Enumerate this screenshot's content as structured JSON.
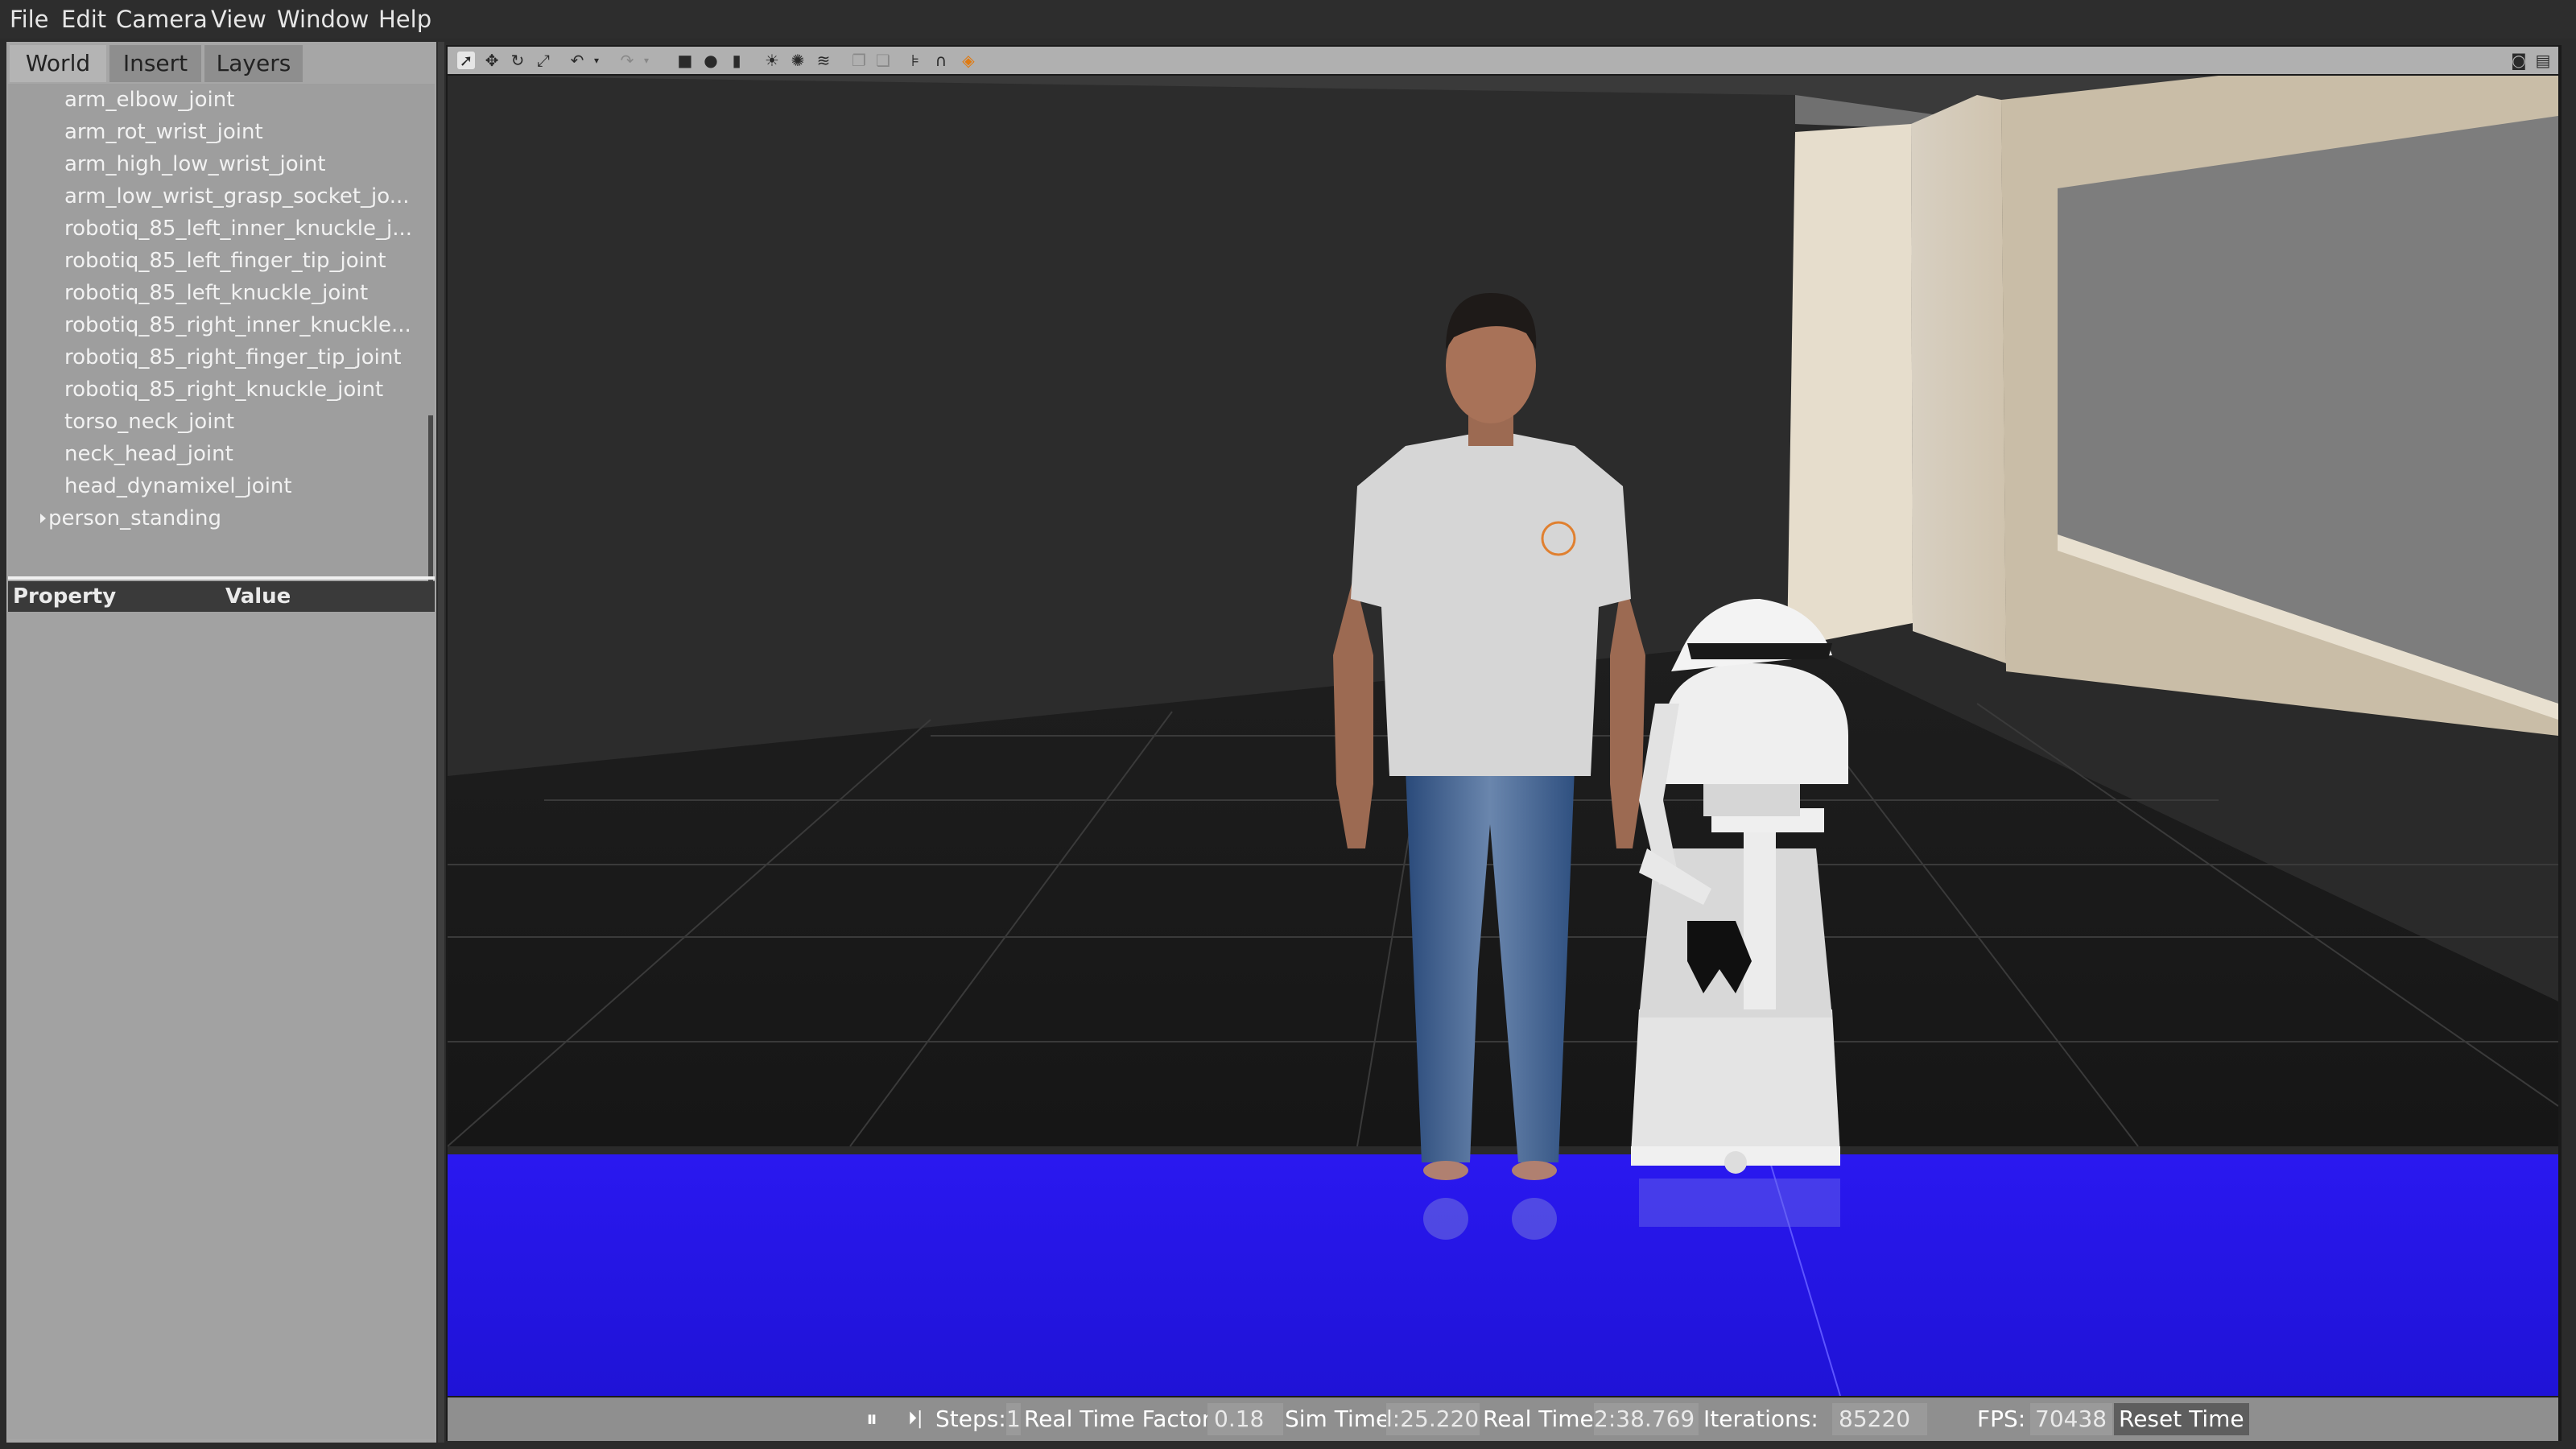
{
  "menu": {
    "items": [
      "File",
      "Edit",
      "Camera",
      "View",
      "Window",
      "Help"
    ]
  },
  "left_panel": {
    "tabs": [
      {
        "label": "World",
        "active": true
      },
      {
        "label": "Insert",
        "active": false
      },
      {
        "label": "Layers",
        "active": false
      }
    ],
    "tree": [
      {
        "label": "arm_elbow_joint"
      },
      {
        "label": "arm_rot_wrist_joint"
      },
      {
        "label": "arm_high_low_wrist_joint"
      },
      {
        "label": "arm_low_wrist_grasp_socket_jo..."
      },
      {
        "label": "robotiq_85_left_inner_knuckle_j..."
      },
      {
        "label": "robotiq_85_left_finger_tip_joint"
      },
      {
        "label": "robotiq_85_left_knuckle_joint"
      },
      {
        "label": "robotiq_85_right_inner_knuckle..."
      },
      {
        "label": "robotiq_85_right_finger_tip_joint"
      },
      {
        "label": "robotiq_85_right_knuckle_joint"
      },
      {
        "label": "torso_neck_joint"
      },
      {
        "label": "neck_head_joint"
      },
      {
        "label": "head_dynamixel_joint"
      }
    ],
    "tree_parent": {
      "label": "person_standing",
      "expanded": false
    },
    "property_header": {
      "property": "Property",
      "value": "Value"
    }
  },
  "toolbar": {
    "icons": [
      "select-arrow-icon",
      "translate-icon",
      "rotate-icon",
      "scale-icon",
      "undo-icon",
      "undo-dropdown-icon",
      "redo-icon",
      "redo-dropdown-icon",
      "box-shape-icon",
      "sphere-shape-icon",
      "cylinder-shape-icon",
      "point-light-icon",
      "spot-light-icon",
      "directional-light-icon",
      "copy-icon",
      "paste-icon",
      "align-icon",
      "snap-icon",
      "change-view-icon",
      "screenshot-icon",
      "record-icon"
    ]
  },
  "status": {
    "steps_label": "Steps:",
    "steps_value": "1",
    "rtf_label": "Real Time Factor:",
    "rtf_value": "0.18",
    "sim_label": "Sim Time:",
    "sim_value": "l:25.220",
    "real_label": "Real Time:",
    "real_value": "2:38.769",
    "iter_label": "Iterations:",
    "iter_value": "85220",
    "fps_label": "FPS:",
    "fps_value": "70438",
    "reset_label": "Reset Time"
  },
  "colors": {
    "panel_bg": "#a6a6a6",
    "floor_blue": "#1f13e0",
    "menubar_bg": "#2d2d2d"
  }
}
